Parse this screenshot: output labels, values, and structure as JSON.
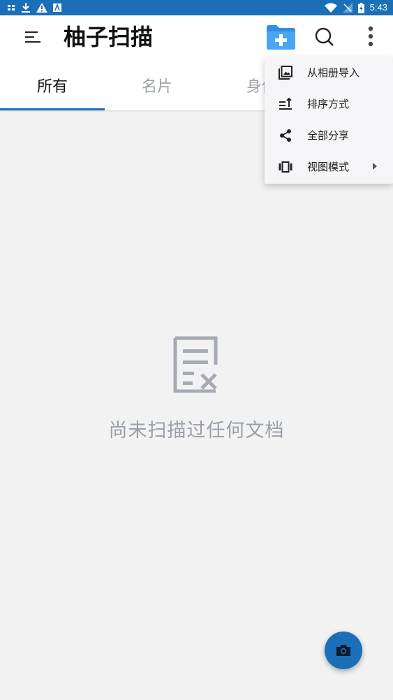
{
  "status_bar": {
    "time": "5:43",
    "left_icons": [
      "sim-notification-icon",
      "download-icon",
      "warning-icon",
      "app-notification-icon"
    ],
    "right_icons": [
      "wifi-icon",
      "no-signal-icon",
      "battery-charging-icon"
    ]
  },
  "app_bar": {
    "title": "柚子扫描",
    "icons": [
      "menu-icon",
      "add-folder-icon",
      "search-icon",
      "more-vert-icon"
    ]
  },
  "tabs": [
    {
      "label": "所有",
      "active": true
    },
    {
      "label": "名片",
      "active": false
    },
    {
      "label": "身份",
      "active": false
    }
  ],
  "empty_state": {
    "icon": "document-remove-icon",
    "message": "尚未扫描过任何文档"
  },
  "overflow_menu": {
    "items": [
      {
        "label": "从相册导入",
        "icon": "gallery-icon"
      },
      {
        "label": "排序方式",
        "icon": "sort-icon"
      },
      {
        "label": "全部分享",
        "icon": "share-icon"
      },
      {
        "label": "视图模式",
        "icon": "view-carousel-icon",
        "has_submenu": true
      }
    ]
  },
  "fab": {
    "icon": "camera-icon"
  },
  "colors": {
    "primary": "#1b6fb8",
    "folder": "#3a97e8",
    "background": "#f2f2f3",
    "muted_text": "#9aa0a8"
  }
}
